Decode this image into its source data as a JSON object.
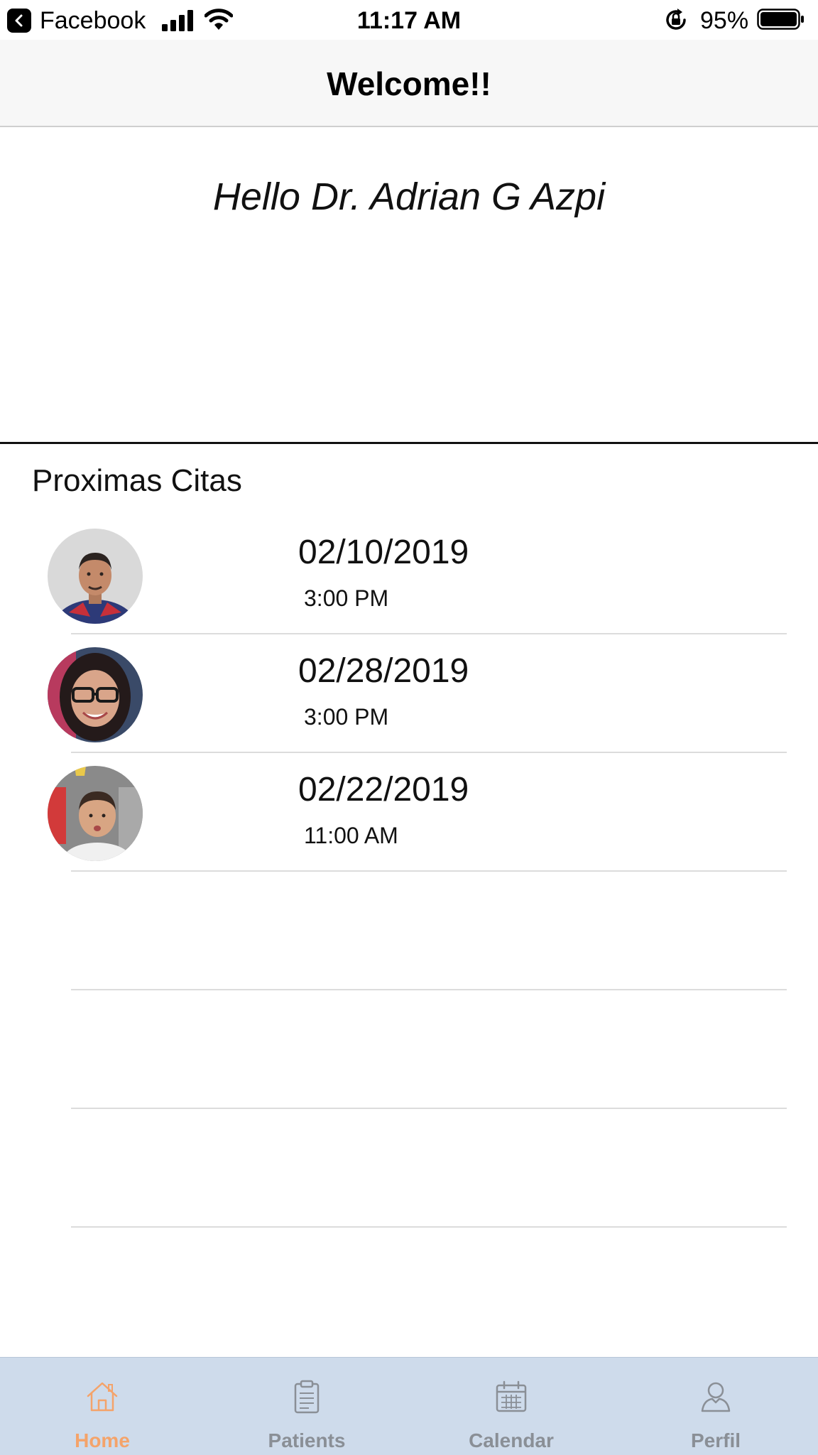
{
  "status_bar": {
    "back_app": "Facebook",
    "time": "11:17 AM",
    "battery": "95%"
  },
  "nav": {
    "title": "Welcome!!"
  },
  "greeting": "Hello Dr. Adrian G Azpi",
  "section_title": "Proximas Citas",
  "appointments": [
    {
      "date": "02/10/2019",
      "time": "3:00 PM"
    },
    {
      "date": "02/28/2019",
      "time": "3:00 PM"
    },
    {
      "date": "02/22/2019",
      "time": "11:00 AM"
    }
  ],
  "tabs": [
    {
      "label": "Home",
      "icon": "home-icon",
      "active": true
    },
    {
      "label": "Patients",
      "icon": "clipboard-icon",
      "active": false
    },
    {
      "label": "Calendar",
      "icon": "calendar-icon",
      "active": false
    },
    {
      "label": "Perfil",
      "icon": "person-icon",
      "active": false
    }
  ],
  "colors": {
    "tab_bar": "#cedbeb",
    "tab_active": "#f4a36a",
    "tab_inactive": "#8a8f96",
    "nav_bar": "#f7f7f7"
  }
}
